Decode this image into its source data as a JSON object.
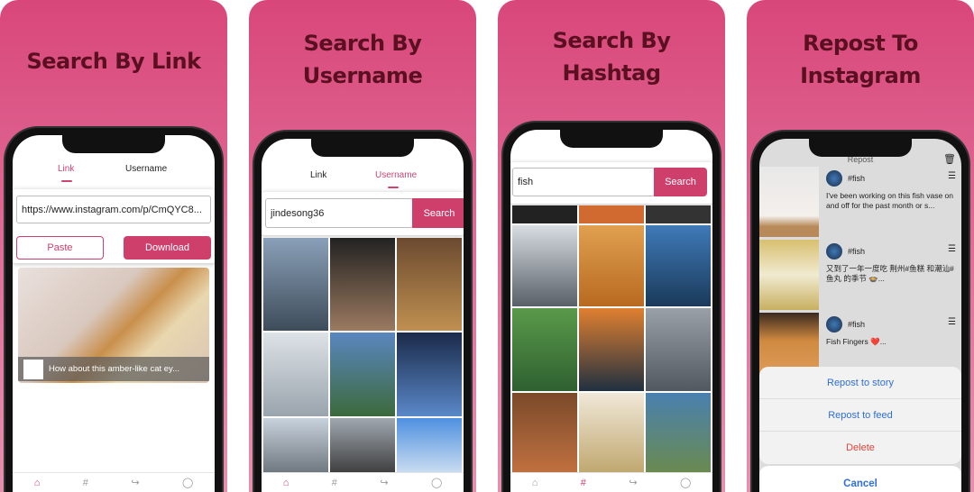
{
  "panels": [
    {
      "title_line1": "Search By Link"
    },
    {
      "title_line1": "Search By",
      "title_line2": "Username"
    },
    {
      "title_line1": "Search By",
      "title_line2": "Hashtag"
    },
    {
      "title_line1": "Repost To",
      "title_line2": "Instagram"
    }
  ],
  "tabs": {
    "link": "Link",
    "username": "Username"
  },
  "link_screen": {
    "url_value": "https://www.instagram.com/p/CmQYC8...",
    "paste": "Paste",
    "download": "Download",
    "caption": "How about this amber-like cat ey..."
  },
  "username_screen": {
    "input_value": "jindesong36",
    "search": "Search"
  },
  "hashtag_screen": {
    "input_value": "fish",
    "search": "Search"
  },
  "repost_screen": {
    "header": "Repost",
    "posts": [
      {
        "tag": "#fish",
        "text": "I've been working on this fish vase on and off for the past month or s..."
      },
      {
        "tag": "#fish",
        "text": "又到了一年一度吃 荆州#鱼糕 和潮汕#鱼丸 的季节 🍲..."
      },
      {
        "tag": "#fish",
        "text": "Fish Fingers ❤️..."
      }
    ],
    "actions": {
      "story": "Repost to story",
      "feed": "Repost to feed",
      "delete": "Delete",
      "cancel": "Cancel"
    }
  },
  "nav_icons": [
    "home-icon",
    "hashtag-icon",
    "share-icon",
    "user-icon"
  ],
  "colors": {
    "accent": "#cf3f6c",
    "background": "#d9477a",
    "title": "#5a1020",
    "delete": "#e0453a",
    "action": "#2f6fd6"
  }
}
